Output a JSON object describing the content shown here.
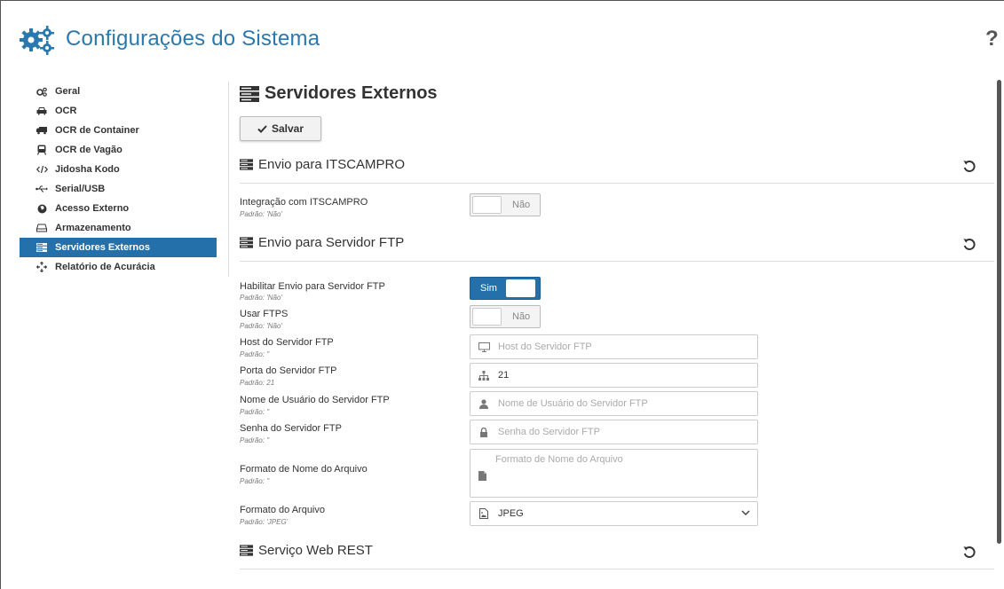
{
  "header": {
    "title": "Configurações do Sistema",
    "help": "?",
    "icon": "gears-icon"
  },
  "sidebar": {
    "items": [
      {
        "label": "Geral",
        "icon": "gears-icon"
      },
      {
        "label": "OCR",
        "icon": "car-icon"
      },
      {
        "label": "OCR de Container",
        "icon": "truck-icon"
      },
      {
        "label": "OCR de Vagão",
        "icon": "train-icon"
      },
      {
        "label": "Jidosha Kodo",
        "icon": "code-icon"
      },
      {
        "label": "Serial/USB",
        "icon": "usb-icon"
      },
      {
        "label": "Acesso Externo",
        "icon": "globe-icon"
      },
      {
        "label": "Armazenamento",
        "icon": "hdd-icon"
      },
      {
        "label": "Servidores Externos",
        "icon": "server-icon",
        "active": true
      },
      {
        "label": "Relatório de Acurácia",
        "icon": "crosshairs-icon"
      }
    ]
  },
  "main": {
    "title": "Servidores Externos",
    "save_label": "Salvar",
    "sections": {
      "itscampro": {
        "title": "Envio para ITSCAMPRO",
        "fields": {
          "integracao": {
            "label": "Integração com ITSCAMPRO",
            "default": "Padrão: 'Não'",
            "value": "Não"
          }
        }
      },
      "ftp": {
        "title": "Envio para Servidor FTP",
        "fields": {
          "habilitar": {
            "label": "Habilitar Envio para Servidor FTP",
            "default": "Padrão: 'Não'",
            "value": "Sim"
          },
          "ftps": {
            "label": "Usar FTPS",
            "default": "Padrão: 'Não'",
            "value": "Não"
          },
          "host": {
            "label": "Host do Servidor FTP",
            "default": "Padrão: ''",
            "placeholder": "Host do Servidor FTP",
            "value": ""
          },
          "porta": {
            "label": "Porta do Servidor FTP",
            "default": "Padrão: 21",
            "placeholder": "",
            "value": "21"
          },
          "usuario": {
            "label": "Nome de Usuário do Servidor FTP",
            "default": "Padrão: ''",
            "placeholder": "Nome de Usuário do Servidor FTP",
            "value": ""
          },
          "senha": {
            "label": "Senha do Servidor FTP",
            "default": "Padrão: ''",
            "placeholder": "Senha do Servidor FTP",
            "value": ""
          },
          "formato_nome": {
            "label": "Formato de Nome do Arquivo",
            "default": "Padrão: ''",
            "placeholder": "Formato de Nome do Arquivo",
            "value": ""
          },
          "formato_arquivo": {
            "label": "Formato do Arquivo",
            "default": "Padrão: 'JPEG'",
            "value": "JPEG"
          }
        }
      },
      "rest": {
        "title": "Serviço Web REST"
      }
    }
  },
  "colors": {
    "accent": "#2370ab",
    "title": "#2a79ae"
  }
}
